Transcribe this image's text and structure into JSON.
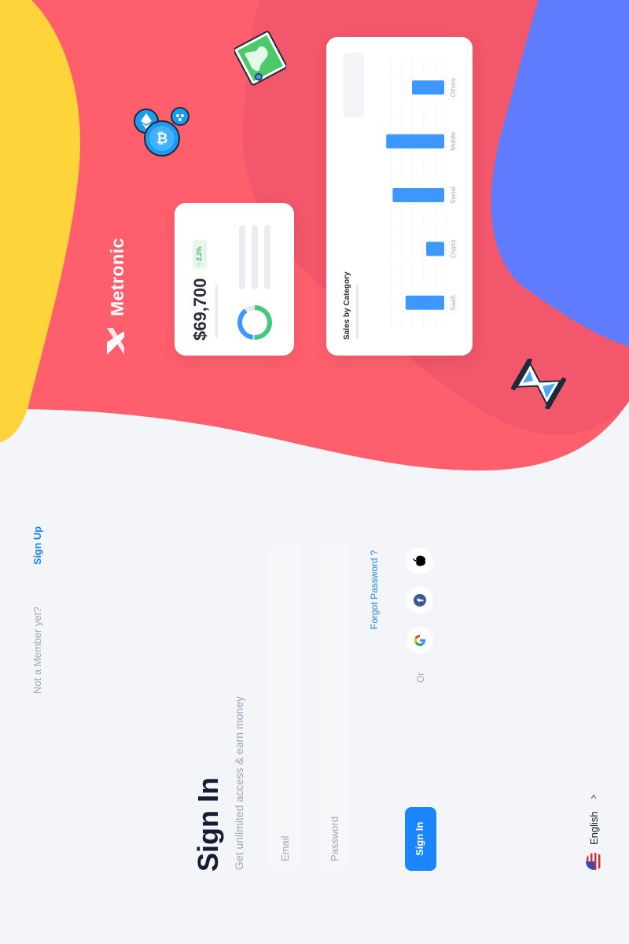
{
  "brand": {
    "name": "Metronic",
    "colors": {
      "coral": "#ff5f6d",
      "coral_dark": "#f2566a",
      "yellow": "#ffd43b",
      "blue_blob": "#5f7cff",
      "accent": "#1b84ff"
    }
  },
  "stat_card": {
    "value": "$69,700",
    "change": "↑ 2.2%",
    "donut_icon": "donut-chart-icon"
  },
  "sales_card": {
    "title": "Sales by Category",
    "chart_data": {
      "type": "bar",
      "orientation": "horizontal",
      "categories": [
        "SaaS",
        "Crypto",
        "Social",
        "Mobile",
        "Others"
      ],
      "values": [
        0.6,
        0.28,
        0.8,
        0.9,
        0.5
      ],
      "value_scale": "relative (no axis values printed)",
      "grid": true
    }
  },
  "decorations": [
    "map-icon",
    "crypto-coins-icon",
    "hourglass-icon"
  ],
  "signin": {
    "title": "Sign In",
    "subtitle": "Get unlimited access & earn money",
    "email_placeholder": "Email",
    "password_placeholder": "Password",
    "forgot_label": "Forgot Password ?",
    "or_label": "Or",
    "submit_label": "Sign In",
    "social": [
      "google-icon",
      "facebook-icon",
      "apple-icon"
    ]
  },
  "footer": {
    "member_text": "Not a Member yet?",
    "signup_label": "Sign Up",
    "language": "English",
    "language_flag": "us-flag-icon"
  }
}
